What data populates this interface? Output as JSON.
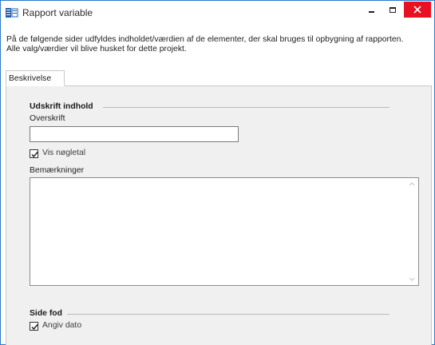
{
  "window": {
    "title": "Rapport variable",
    "controls": {
      "minimize": "minimize",
      "maximize": "maximize",
      "close": "close"
    },
    "accent_color": "#2b79c9",
    "close_color": "#e81123"
  },
  "info": {
    "line1": "På de følgende sider udfyldes indholdet/værdien af de elementer, der skal bruges til opbygning af rapporten.",
    "line2": "Alle valg/værdier vil blive husket for dette projekt."
  },
  "tabs": [
    {
      "label": "Beskrivelse",
      "selected": true
    }
  ],
  "sections": {
    "udskrift": {
      "title": "Udskrift indhold",
      "overskrift_label": "Overskrift",
      "overskrift_value": "",
      "vis_noegletal_label": "Vis nøgletal",
      "vis_noegletal_checked": true,
      "bemaerkninger_label": "Bemærkninger",
      "bemaerkninger_value": ""
    },
    "sidefod": {
      "title": "Side fod",
      "angiv_dato_label": "Angiv dato",
      "angiv_dato_checked": true
    }
  },
  "icons": {
    "app": "report-app-icon",
    "check": "checkmark-icon",
    "scroll_up": "chevron-up-icon",
    "scroll_down": "chevron-down-icon"
  }
}
